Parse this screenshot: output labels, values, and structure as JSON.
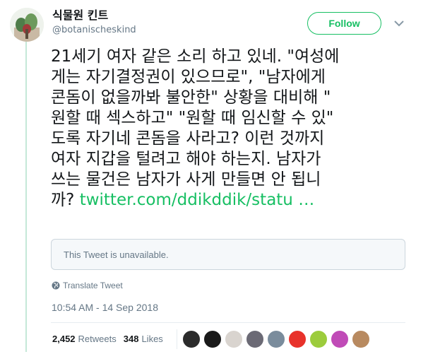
{
  "user": {
    "display_name": "식물원 킨트",
    "handle": "@botanischeskind"
  },
  "follow_label": "Follow",
  "tweet": {
    "lines": [
      "21세기 여자 같은 소리 하고 있네. \"여성에",
      "게는 자기결정권이 있으므로\", \"남자에게",
      "콘돔이 없을까봐 불안한\" 상황을 대비해 \"",
      "원할 때 섹스하고\" \"원할 때 임신할 수 있\"",
      "도록 자기네 콘돔을 사라고? 이런 것까지",
      "여자 지갑을 털려고 해야 하는지. 남자가",
      "쓰는 물건은 남자가 사게 만들면 안 됩니"
    ],
    "last_line_prefix": "까? ",
    "link_text": "twitter.com/ddikddik/statu …"
  },
  "quote": {
    "text": "This Tweet is unavailable."
  },
  "translate_label": "Translate Tweet",
  "timestamp": "10:54 AM - 14 Sep 2018",
  "stats": {
    "retweets_count": "2,452",
    "retweets_label": "Retweets",
    "likes_count": "348",
    "likes_label": "Likes"
  },
  "colors": {
    "accent": "#17bf63",
    "thread_line": "#c5e8d8",
    "secondary_text": "#657786"
  },
  "likers": [
    {
      "name": "liker-avatar-1",
      "color": "#2b2b2b"
    },
    {
      "name": "liker-avatar-2",
      "color": "#1a1a1a"
    },
    {
      "name": "liker-avatar-3",
      "color": "#d9d4cf"
    },
    {
      "name": "liker-avatar-4",
      "color": "#6b6a75"
    },
    {
      "name": "liker-avatar-5",
      "color": "#7a8c9c"
    },
    {
      "name": "liker-avatar-6",
      "color": "#e8322b"
    },
    {
      "name": "liker-avatar-7",
      "color": "#9ccc3c"
    },
    {
      "name": "liker-avatar-8",
      "color": "#c04bb7"
    },
    {
      "name": "liker-avatar-9",
      "color": "#b88a60"
    }
  ]
}
